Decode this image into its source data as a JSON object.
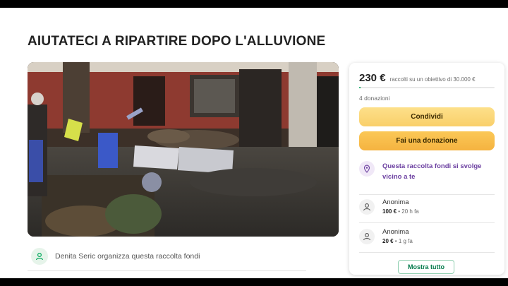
{
  "campaign": {
    "title": "AIUTATECI A RIPARTIRE DOPO L'ALLUVIONE",
    "organizer_text": "Denita Seric organizza questa raccolta fondi"
  },
  "donation_card": {
    "amount": "230 €",
    "goal_text": "raccolti su un obiettivo di 30.000 €",
    "progress_fraction": 0.0077,
    "donations_count": "4 donazioni",
    "share_label": "Condividi",
    "donate_label": "Fai una donazione",
    "notice_text": "Questa raccolta fondi si svolge vicino a te",
    "donors": [
      {
        "name": "Anonima",
        "amount": "100 €",
        "time": "20 h fa"
      },
      {
        "name": "Anonima",
        "amount": "20 €",
        "time": "1 g fa"
      }
    ],
    "show_all_label": "Mostra tutto"
  },
  "colors": {
    "accent_green": "#02a95c",
    "button_yellow": "#f9cf6a",
    "notice_purple": "#6b3fa0"
  }
}
